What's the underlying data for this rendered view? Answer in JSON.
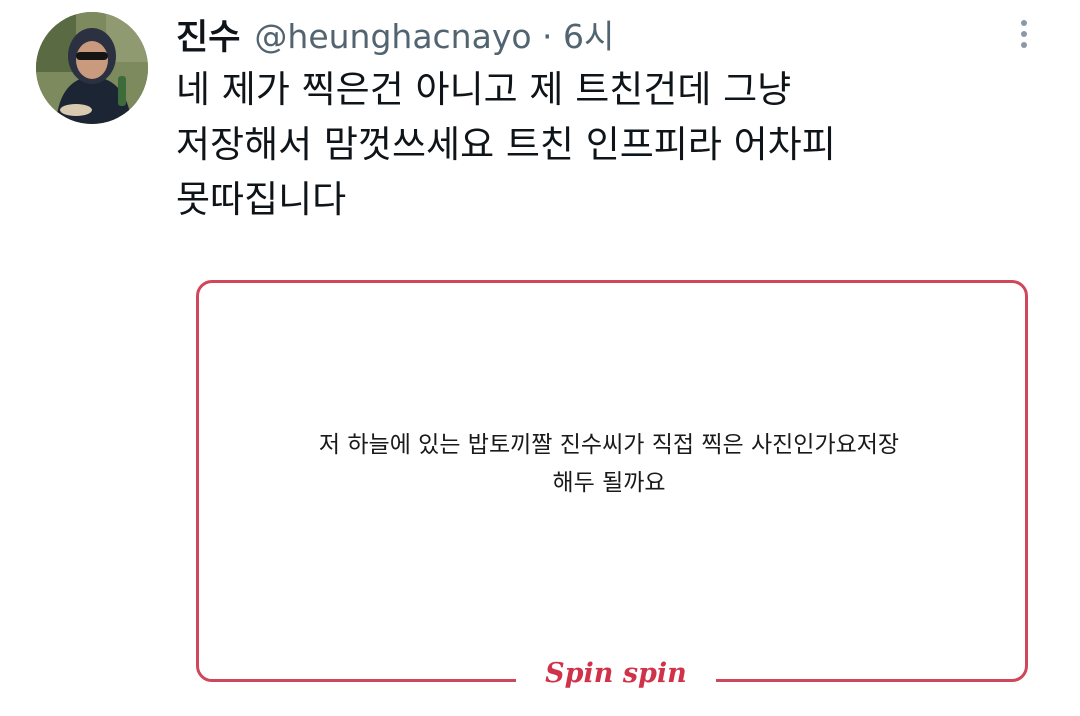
{
  "tweet": {
    "author_name": "진수",
    "author_handle": "@heunghacnayo",
    "separator": "·",
    "time": "6시",
    "text": "네 제가 찍은건 아니고 제 트친건데 그냥\n저장해서 맘껏쓰세요 트친 인프피라 어차피\n못따집니다",
    "more_icon": "more-vertical-icon"
  },
  "media": {
    "question_text": "저 하늘에 있는 밥토끼짤 진수씨가 직접 찍은 사진인가요저장\n해두 될까요",
    "brand_text": "Spin spin",
    "frame_color": "#d0475a",
    "brand_color": "#d0324a"
  }
}
